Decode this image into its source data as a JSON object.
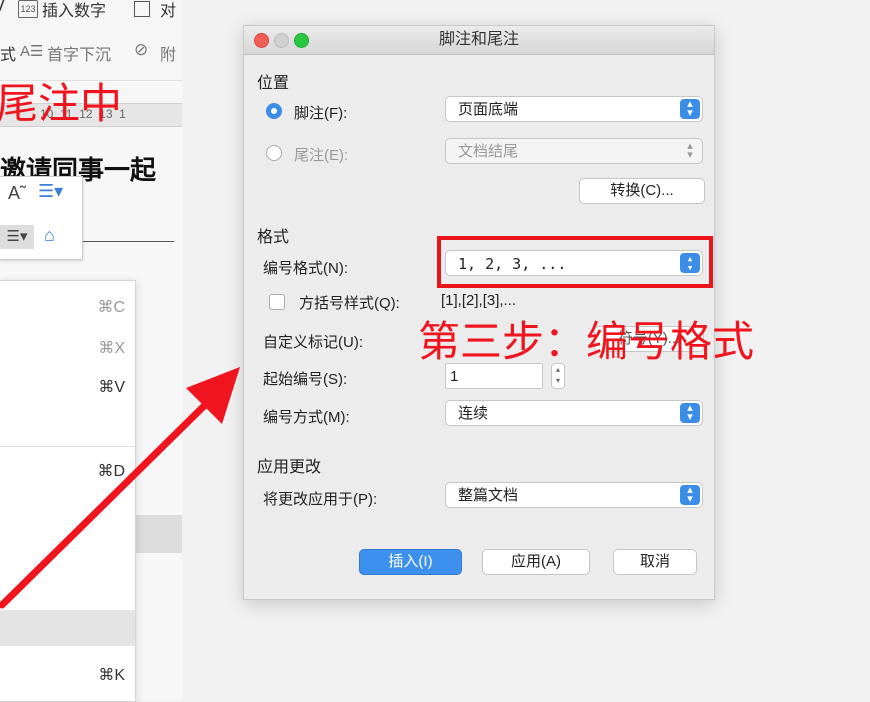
{
  "doc": {
    "toolbar": {
      "insert_number": "插入数字",
      "cut_text": "对",
      "drop_cap": "首字下沉",
      "attach_text": "附",
      "ruler_nums": "10  11  12  13  1"
    },
    "title_fragment": "邀请同事一起"
  },
  "context_menu": {
    "shortcuts": [
      "⌘C",
      "⌘X",
      "⌘V",
      "⌘D",
      "⌘K"
    ]
  },
  "dialog": {
    "title": "脚注和尾注",
    "location": {
      "heading": "位置",
      "footnote_label": "脚注(F):",
      "footnote_value": "页面底端",
      "endnote_label": "尾注(E):",
      "endnote_value": "文档结尾",
      "convert_button": "转换(C)..."
    },
    "format": {
      "heading": "格式",
      "number_format_label": "编号格式(N):",
      "number_format_value": "1, 2, 3, ...",
      "bracket_label": "方括号样式(Q):",
      "bracket_example": "[1],[2],[3],...",
      "custom_mark_label": "自定义标记(U):",
      "symbol_button": "符号(Y)...",
      "start_label": "起始编号(S):",
      "start_value": "1",
      "numbering_label": "编号方式(M):",
      "numbering_value": "连续"
    },
    "apply": {
      "heading": "应用更改",
      "apply_to_label": "将更改应用于(P):",
      "apply_to_value": "整篇文档"
    },
    "buttons": {
      "insert": "插入(I)",
      "apply": "应用(A)",
      "cancel": "取消"
    }
  },
  "annotations": {
    "left_red_text": "尾注中",
    "step_text": "第三步：编号格式"
  },
  "colors": {
    "accent": "#3b8de8",
    "annotation_red": "#f0141e"
  }
}
